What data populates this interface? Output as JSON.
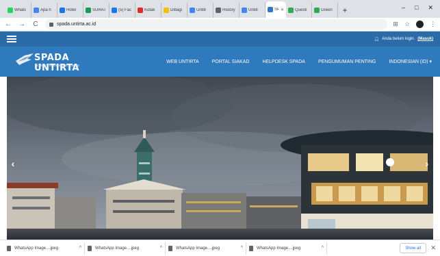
{
  "browser": {
    "tabs": [
      {
        "title": "Whats",
        "color": "#25d366"
      },
      {
        "title": "Apa h",
        "color": "#4285f4"
      },
      {
        "title": "Hotel",
        "color": "#1a73e8"
      },
      {
        "title": "SURAT",
        "color": "#0f9d58"
      },
      {
        "title": "(5) Fac",
        "color": "#1877f2"
      },
      {
        "title": "Kotak",
        "color": "#d93025"
      },
      {
        "title": "Dibagi",
        "color": "#fbbc04"
      },
      {
        "title": "Untitl",
        "color": "#4285f4"
      },
      {
        "title": "History",
        "color": "#5f6368"
      },
      {
        "title": "Untitl",
        "color": "#4285f4"
      },
      {
        "title": "SP",
        "color": "#2f79bd",
        "active": true
      },
      {
        "title": "Questi",
        "color": "#34a853"
      },
      {
        "title": "Green",
        "color": "#34a853"
      }
    ],
    "new_tab": "+",
    "window_controls": {
      "minimize": "–",
      "maximize": "□",
      "close": "✕"
    },
    "back": "←",
    "forward": "→",
    "reload": "C",
    "url": "spada.untirta.ac.id"
  },
  "site": {
    "login_text": "Anda belum login.",
    "login_link": "(Masuk)",
    "brand_title": "SPADA UNTIRTA",
    "brand_subtitle": "Sistem Pembelajaran Daring",
    "menu": [
      "WEB UNTIRTA",
      "PORTAL SIAKAD",
      "HELPDESK SPADA",
      "PENGUMUMAN PENTING",
      "INDONESIAN (ID) ▾"
    ],
    "slider_prev": "‹",
    "slider_next": "›"
  },
  "downloads": {
    "items": [
      "WhatsApp Image....jpeg",
      "WhatsApp Image....jpeg",
      "WhatsApp Image....jpeg",
      "WhatsApp Image....jpeg"
    ],
    "show_all": "Show all",
    "close": "✕"
  },
  "colors": {
    "site_header": "#2b6ca8",
    "site_nav": "#2f79bd",
    "chrome_tabstrip": "#dee1e6"
  }
}
